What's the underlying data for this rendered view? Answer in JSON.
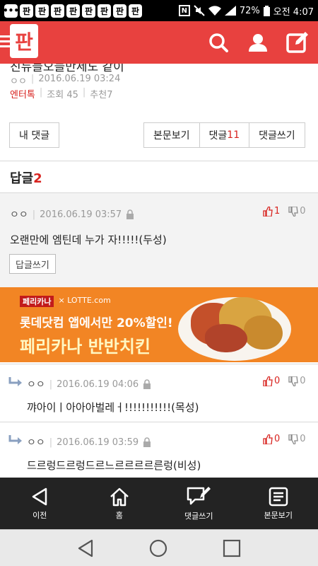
{
  "status_bar": {
    "app_badges": [
      "판",
      "판",
      "판",
      "판",
      "판",
      "판",
      "판",
      "판"
    ],
    "n_badge": "N",
    "battery": "72%",
    "time": "오전 4:07"
  },
  "header": {
    "logo": "판"
  },
  "article": {
    "title": "친듀들오늘만세도 같이",
    "author": "ㅇㅇ",
    "date": "2016.06.19 03:24",
    "category": "엔터톡",
    "views": "조회 45",
    "recommend": "추천7"
  },
  "buttons": {
    "my_comments": "내 댓글",
    "view_post": "본문보기",
    "comments_label": "댓글",
    "comments_count": "11",
    "write_comment": "댓글쓰기"
  },
  "replies_header": {
    "label": "답글",
    "count": "2"
  },
  "comment": {
    "nick": "ㅇㅇ",
    "date": "2016.06.19 03:57",
    "text": "오랜만에 엠틴데 누가 자!!!!!(두성)",
    "up": "1",
    "down": "0",
    "reply_btn": "답글쓰기"
  },
  "ad": {
    "brand1": "페리카나",
    "brand2": "× LOTTE.com",
    "line1": "롯데닷컴 앱에서만 20%할인!",
    "line2": "페리카나 반반치킨"
  },
  "replies": [
    {
      "nick": "ㅇㅇ",
      "date": "2016.06.19 04:06",
      "text": "꺄아이ㅣ아아아벌레ㅓ!!!!!!!!!!!(목성)",
      "up": "0",
      "down": "0"
    },
    {
      "nick": "ㅇㅇ",
      "date": "2016.06.19 03:59",
      "text": "드르렁드르렁드르느르르르르른렁(비성)",
      "up": "0",
      "down": "0"
    }
  ],
  "app_nav": {
    "prev": "이전",
    "home": "홈",
    "write": "댓글쓰기",
    "view": "본문보기"
  },
  "colors": {
    "brand_red": "#e8413f",
    "accent_red": "#d8231f",
    "ad_orange": "#f28524"
  }
}
